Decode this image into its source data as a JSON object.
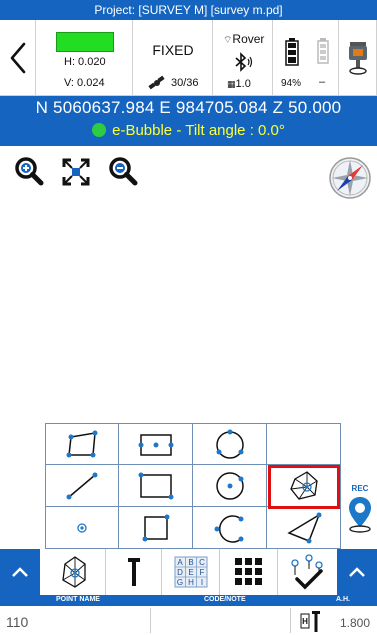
{
  "title": "Project: [SURVEY M] [survey m.pd]",
  "status": {
    "h": "H: 0.020",
    "v": "V: 0.024",
    "solution": "FIXED",
    "satellites": "30/36",
    "mode": "Rover",
    "version": "1.0",
    "battery_pct": "94%",
    "battery2": "–",
    "quality_color": "#22dd22"
  },
  "coords": {
    "line": "N 5060637.984  E 984705.084  Z 50.000",
    "bubble": "e-Bubble - Tilt angle : 0.0°"
  },
  "map_tools": [
    "zoom-in-icon",
    "zoom-extents-icon",
    "zoom-out-icon",
    "compass-icon"
  ],
  "rec_label": "REC",
  "toolbar_items": [
    "polygon-stakeout-icon",
    "pole-icon",
    "codes-icon",
    "keypad-icon",
    "stakeout-check-icon"
  ],
  "labels": {
    "point_name": "POINT NAME",
    "code_note": "CODE/NOTE",
    "ah": "A.H."
  },
  "bottom": {
    "point_name": "110",
    "antenna_height": "1.800"
  },
  "code_letters": "ABC DEF GHI",
  "accent": "#1565c0",
  "highlight": "#e01010"
}
